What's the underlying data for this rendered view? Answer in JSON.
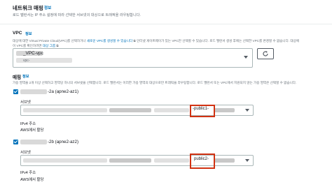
{
  "header": {
    "title": "네트워크 매핑",
    "info": "정보",
    "description": "로드 밸런서는 IP 주소 설정에 따라 선택한 서브넷의 대상으로 트래픽을 라우팅합니다."
  },
  "vpc": {
    "label": "VPC",
    "info": "정보",
    "desc_before": "대상에 대한 Virtual Private Cloud(VPC)를 선택하거나",
    "desc_link": "새로운 VPC를 생성할 수 있습니다",
    "desc_after": "인터넷 게이트웨이가 있는 VPC만 선택할 수 있습니다. 로드 밸런서 생성 후에는 선택한 VPC를 변경할 수 없습니다. 대상에",
    "desc2_before": "이 VPC를 확인하려면",
    "desc2_link": "대상 그룹",
    "desc2_after": "을 확인하십시오.",
    "selected_name": "_VPC-vpc",
    "selected_id": "vpc-"
  },
  "mappings": {
    "label": "매핑",
    "info": "정보",
    "description": "가용 영역을 2개 이상 선택하고 영역당 하나의 서브넷을 선택합니다. 로드 밸런서는 이러한 가용 영역의 대상으로만 트래픽을 라우팅합니다. 로드 밸런서 또는 VPC에서 지원되지 않는 가용 영역은 선택할 수 없습니다.",
    "zones": [
      {
        "name": "-2a (apne2-az1)",
        "subnet_label": "서브넷",
        "subnet_text": "-public1-",
        "ipv4_label": "IPv4 주소",
        "ipv4_value": "AWS에서 할당"
      },
      {
        "name": "-2b (apne2-az2)",
        "subnet_label": "서브넷",
        "subnet_text": "public2-",
        "ipv4_label": "IPv4 주소",
        "ipv4_value": "AWS에서 할당"
      }
    ]
  },
  "colors": {
    "link": "#0073bb",
    "checkbox": "#0073bb",
    "highlight": "#d13212",
    "muted": "#687078"
  }
}
